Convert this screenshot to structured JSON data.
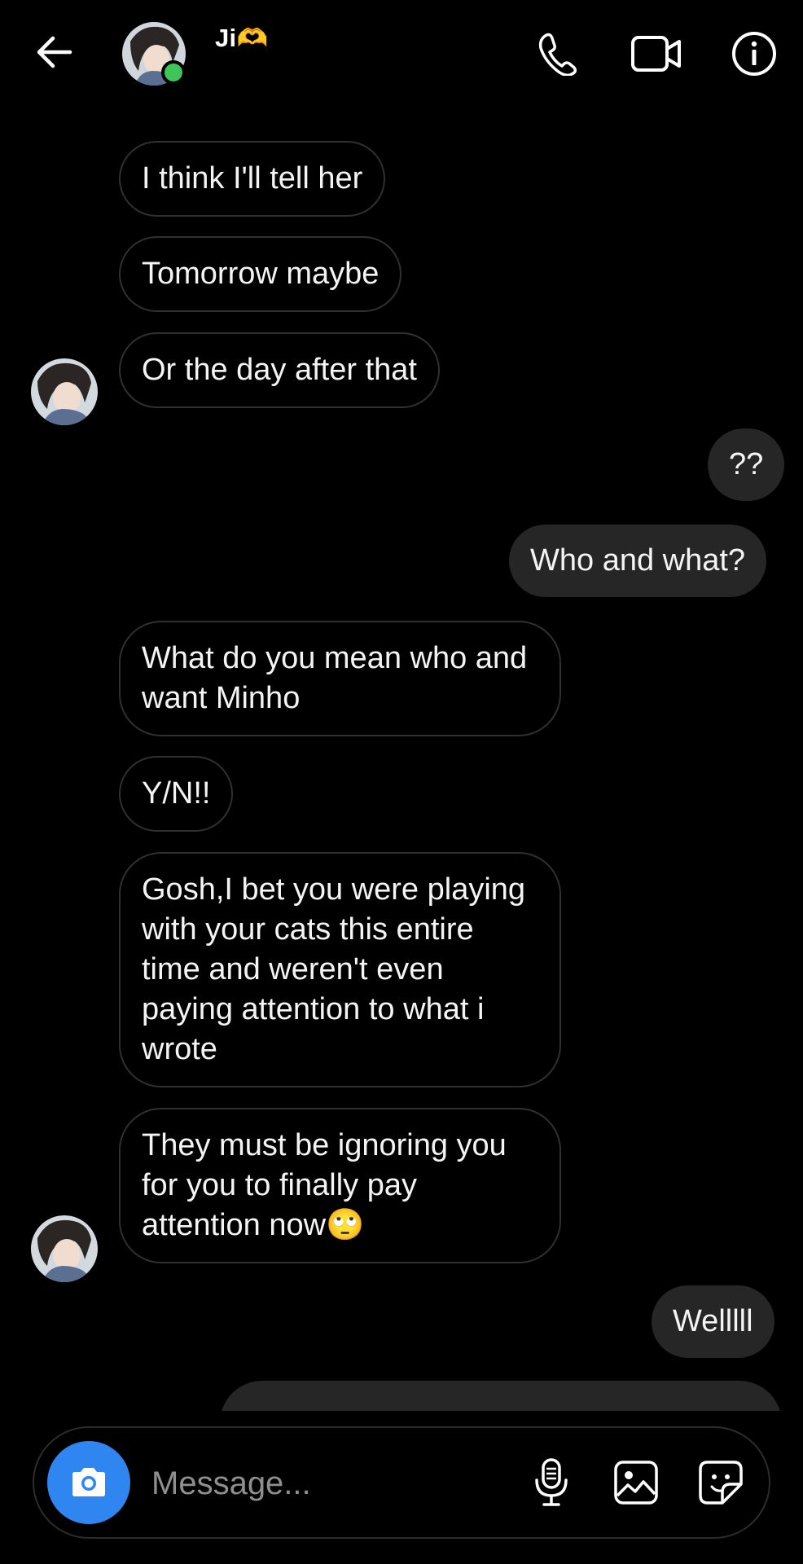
{
  "header": {
    "contact_name": "Ji🫶"
  },
  "messages": [
    {
      "text": "I think I'll tell her",
      "dir": "in"
    },
    {
      "text": "Tomorrow maybe",
      "dir": "in"
    },
    {
      "text": "Or the day after that",
      "dir": "in"
    },
    {
      "text": "??",
      "dir": "out"
    },
    {
      "text": "Who and what?",
      "dir": "out"
    },
    {
      "text": "What do you mean who and want Minho",
      "dir": "in"
    },
    {
      "text": "Y/N!!",
      "dir": "in"
    },
    {
      "text": "Gosh,I bet you were playing with your cats this entire time and weren't even paying attention to what i wrote",
      "dir": "in"
    },
    {
      "text": "They must be ignoring you for you to finally pay attention now🙄",
      "dir": "in"
    },
    {
      "text": "Welllll",
      "dir": "out"
    },
    {
      "text": "",
      "dir": "out"
    }
  ],
  "composer": {
    "placeholder": "Message..."
  },
  "colors": {
    "background": "#000000",
    "outgoing_bubble": "#262626",
    "incoming_border": "#303030",
    "online_dot": "#3ec55a",
    "camera_button": "#2f86f0",
    "placeholder": "#8f8f8f"
  }
}
